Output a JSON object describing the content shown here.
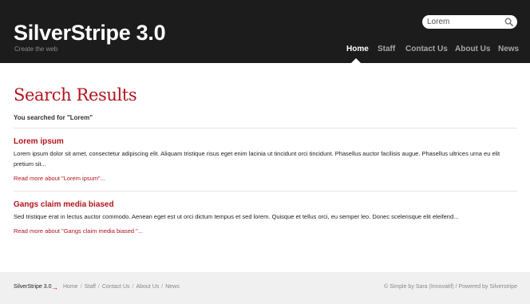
{
  "header": {
    "site_title": "SilverStripe 3.0",
    "tagline": "Create the web",
    "search": {
      "value": "Lorem",
      "placeholder": ""
    },
    "nav": [
      {
        "label": "Home",
        "active": true
      },
      {
        "label": "Staff",
        "active": false
      },
      {
        "label": "Contact Us",
        "active": false
      },
      {
        "label": "About Us",
        "active": false
      },
      {
        "label": "News",
        "active": false
      }
    ]
  },
  "main": {
    "title": "Search Results",
    "summary": "You searched for \"Lorem\"",
    "results": [
      {
        "title": "Lorem ipsum",
        "text": "Lorem ipsum dolor sit amet, consectetur adipiscing elit. Aliquam tristique risus eget enim lacinia ut tincidunt orci tincidunt. Phasellus auctor facilisis augue. Phasellus ultrices urna eu elit pretium sit...",
        "read_more": "Read more about \"Lorem ipsum\"..."
      },
      {
        "title": "Gangs claim media biased",
        "text": "Sed tristique erat in lectus auctor commodo. Aenean eget est ut orci dictum tempus et sed lorem. Quisque et tellus orci, eu semper leo. Donec scelerisque elit eleifend...",
        "read_more": "Read more about \"Gangs claim media biased \"..."
      }
    ]
  },
  "footer": {
    "brand": "SilverStripe 3.0",
    "arrow": "→",
    "links": [
      "Home",
      "Staff",
      "Contact Us",
      "About Us",
      "News"
    ],
    "separator": "/",
    "credit": "© Simple by Sara (Innovatif) / Powered by Silverstripe"
  },
  "colors": {
    "header_bg": "#1c1c1c",
    "accent": "#b3141e",
    "footer_bg": "#f0f0f0"
  },
  "icons": {
    "search": "search-icon"
  }
}
